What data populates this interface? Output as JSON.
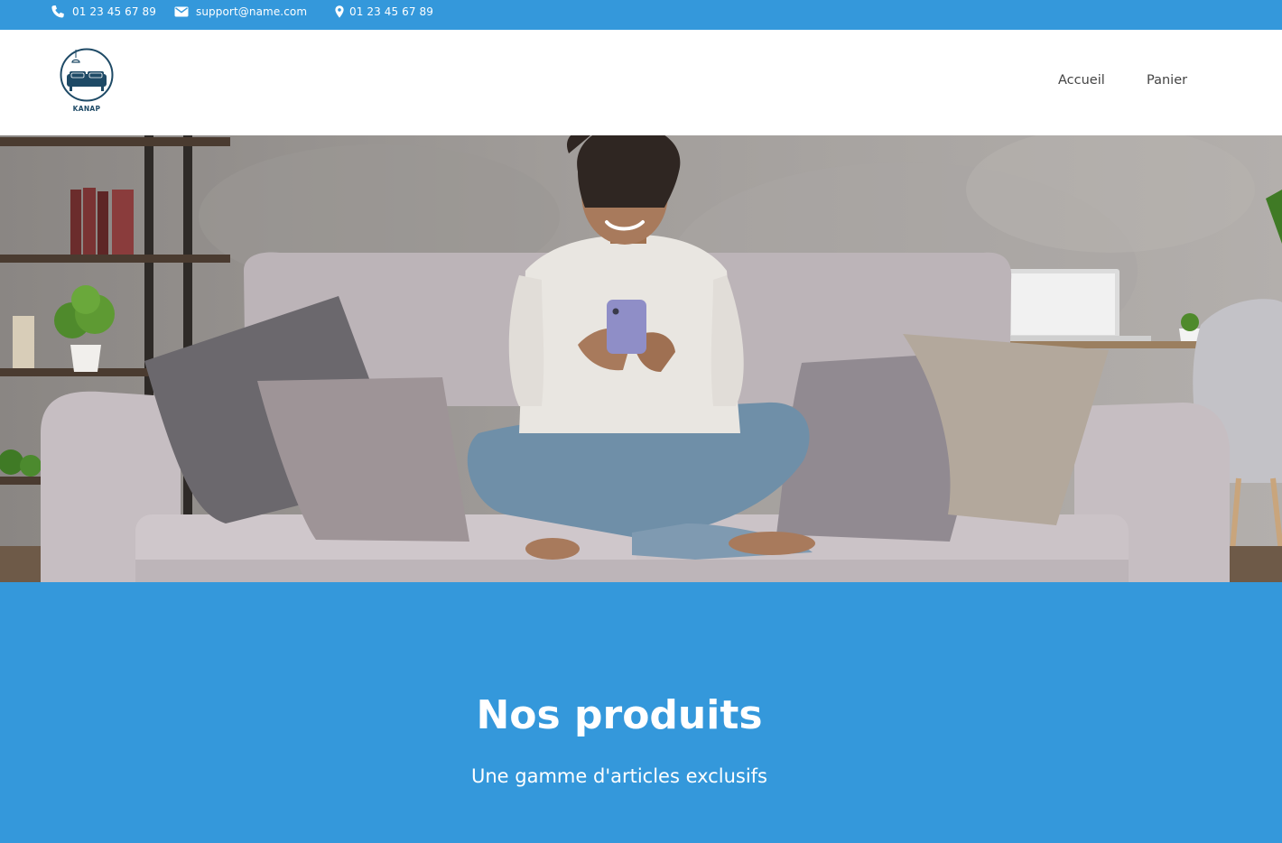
{
  "topbar": {
    "phone": "01 23 45 67 89",
    "email": "support@name.com",
    "location": "01 23 45 67 89",
    "icons": [
      "phone-icon",
      "mail-icon",
      "location-pin-icon"
    ]
  },
  "header": {
    "logo_text": "KANAP",
    "nav": [
      "Accueil",
      "Panier"
    ]
  },
  "hero": {
    "image_subject": "woman-on-sofa-photo"
  },
  "products": {
    "title": "Nos produits",
    "subtitle": "Une gamme d'articles exclusifs"
  },
  "colors": {
    "brand_blue": "#3498db",
    "logo_navy": "#1e4a66",
    "white": "#ffffff"
  }
}
